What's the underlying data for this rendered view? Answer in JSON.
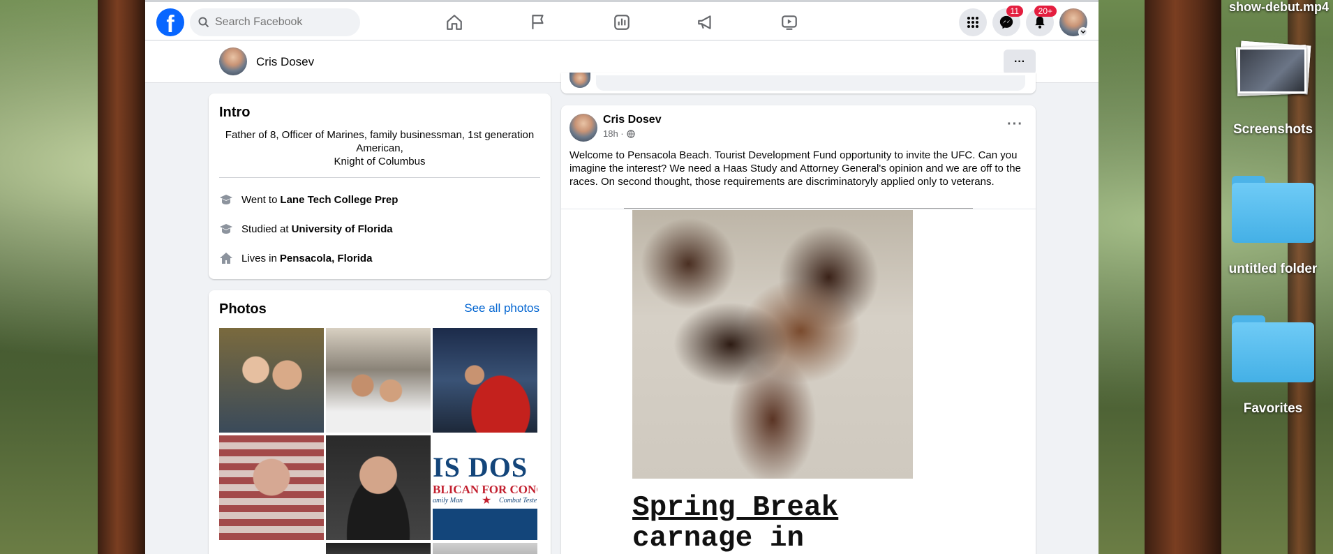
{
  "desktop": {
    "top_label": "show-debut.mp4",
    "items": [
      {
        "label": "Screenshots"
      },
      {
        "label": "untitled folder"
      },
      {
        "label": "Favorites"
      }
    ]
  },
  "topbar": {
    "search_placeholder": "Search Facebook",
    "messenger_badge": "11",
    "notifications_badge": "20+"
  },
  "profile": {
    "name": "Cris Dosev",
    "more_label": "···"
  },
  "intro": {
    "title": "Intro",
    "bio_line1": "Father of 8, Officer of Marines, family businessman, 1st generation American,",
    "bio_line2": "Knight of Columbus",
    "rows": [
      {
        "prefix": "Went to",
        "value": "Lane Tech College Prep",
        "icon": "graduation-cap-icon"
      },
      {
        "prefix": "Studied at",
        "value": "University of Florida",
        "icon": "graduation-cap-icon"
      },
      {
        "prefix": "Lives in",
        "value": "Pensacola, Florida",
        "icon": "home-icon"
      }
    ]
  },
  "photos": {
    "title": "Photos",
    "see_all": "See all photos",
    "banner_text_1": "IS DOS",
    "banner_text_2": "BLICAN FOR CONG",
    "banner_text_3": "amily Man",
    "banner_text_4": "Combat Teste"
  },
  "post": {
    "author": "Cris Dosev",
    "time": "18h ·",
    "text": "Welcome to Pensacola Beach. Tourist Development Fund opportunity to invite the UFC. Can you imagine the interest? We need a Haas Study and Attorney General's opinion and we are off to the races. On second thought,  those requirements are discriminatoryly applied only to veterans.",
    "image_title_line1": "Spring Break",
    "image_title_line2": "carnage in"
  },
  "colors": {
    "facebook_blue": "#0866ff",
    "link_blue": "#0064d1",
    "badge_red": "#e41e3f"
  }
}
